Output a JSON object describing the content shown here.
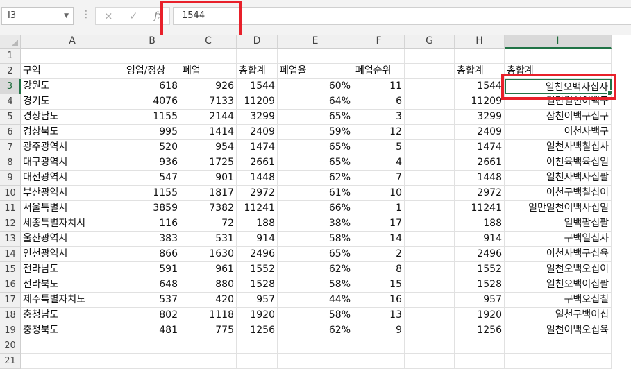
{
  "formula_bar": {
    "name_box": "I3",
    "cancel_icon": "×",
    "enter_icon": "✓",
    "function_label": "fx",
    "formula_value": "1544"
  },
  "columns": [
    "A",
    "B",
    "C",
    "D",
    "E",
    "F",
    "G",
    "H",
    "I"
  ],
  "row_numbers": [
    "1",
    "2",
    "3",
    "4",
    "5",
    "6",
    "7",
    "8",
    "9",
    "10",
    "11",
    "12",
    "13",
    "14",
    "15",
    "16",
    "17",
    "18",
    "19",
    "20",
    "21"
  ],
  "rows": [
    [
      "",
      "",
      "",
      "",
      "",
      "",
      "",
      "",
      ""
    ],
    [
      "구역",
      "영업/정상",
      "폐업",
      "총합계",
      "폐업율",
      "폐업순위",
      "",
      "총합계",
      "총합계"
    ],
    [
      "강원도",
      "618",
      "926",
      "1544",
      "60%",
      "11",
      "",
      "1544",
      "일천오백사십사"
    ],
    [
      "경기도",
      "4076",
      "7133",
      "11209",
      "64%",
      "6",
      "",
      "11209",
      "일만일천이백구"
    ],
    [
      "경상남도",
      "1155",
      "2144",
      "3299",
      "65%",
      "3",
      "",
      "3299",
      "삼천이백구십구"
    ],
    [
      "경상북도",
      "995",
      "1414",
      "2409",
      "59%",
      "12",
      "",
      "2409",
      "이천사백구"
    ],
    [
      "광주광역시",
      "520",
      "954",
      "1474",
      "65%",
      "5",
      "",
      "1474",
      "일천사백칠십사"
    ],
    [
      "대구광역시",
      "936",
      "1725",
      "2661",
      "65%",
      "4",
      "",
      "2661",
      "이천육백육십일"
    ],
    [
      "대전광역시",
      "547",
      "901",
      "1448",
      "62%",
      "7",
      "",
      "1448",
      "일천사백사십팔"
    ],
    [
      "부산광역시",
      "1155",
      "1817",
      "2972",
      "61%",
      "10",
      "",
      "2972",
      "이천구백칠십이"
    ],
    [
      "서울특별시",
      "3859",
      "7382",
      "11241",
      "66%",
      "1",
      "",
      "11241",
      "일만일천이백사십일"
    ],
    [
      "세종특별자치시",
      "116",
      "72",
      "188",
      "38%",
      "17",
      "",
      "188",
      "일백팔십팔"
    ],
    [
      "울산광역시",
      "383",
      "531",
      "914",
      "58%",
      "14",
      "",
      "914",
      "구백일십사"
    ],
    [
      "인천광역시",
      "866",
      "1630",
      "2496",
      "65%",
      "2",
      "",
      "2496",
      "이천사백구십육"
    ],
    [
      "전라남도",
      "591",
      "961",
      "1552",
      "62%",
      "8",
      "",
      "1552",
      "일천오백오십이"
    ],
    [
      "전라북도",
      "648",
      "880",
      "1528",
      "58%",
      "15",
      "",
      "1528",
      "일천오백이십팔"
    ],
    [
      "제주특별자치도",
      "537",
      "420",
      "957",
      "44%",
      "16",
      "",
      "957",
      "구백오십칠"
    ],
    [
      "충청남도",
      "802",
      "1118",
      "1920",
      "58%",
      "13",
      "",
      "1920",
      "일천구백이십"
    ],
    [
      "충청북도",
      "481",
      "775",
      "1256",
      "62%",
      "9",
      "",
      "1256",
      "일천이백오십육"
    ],
    [
      "",
      "",
      "",
      "",
      "",
      "",
      "",
      "",
      ""
    ],
    [
      "",
      "",
      "",
      "",
      "",
      "",
      "",
      "",
      ""
    ]
  ],
  "selection": {
    "cell": "I3",
    "column": "I",
    "row": "3"
  },
  "colors": {
    "accent": "#217346",
    "highlight": "#e8202a"
  }
}
